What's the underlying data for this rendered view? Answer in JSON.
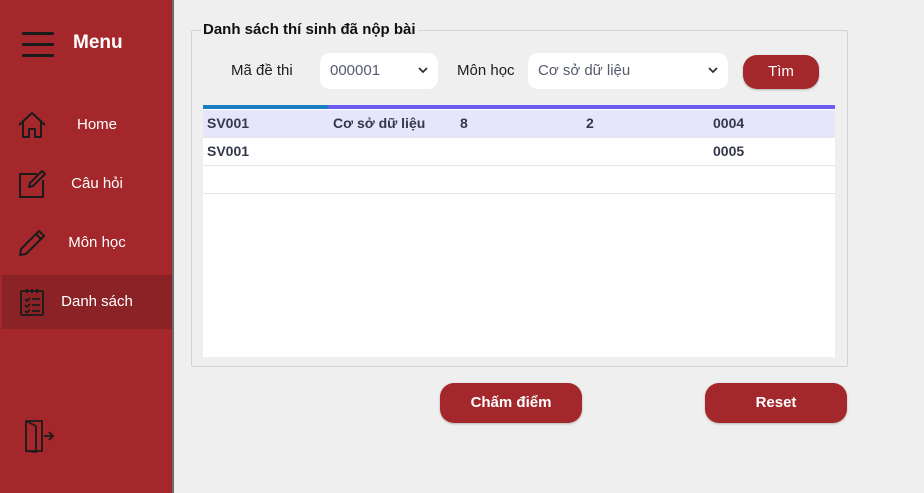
{
  "sidebar": {
    "menu_label": "Menu",
    "items": [
      {
        "label": "Home",
        "icon": "home-icon"
      },
      {
        "label": "Câu hỏi",
        "icon": "edit-icon"
      },
      {
        "label": "Môn học",
        "icon": "pencil-icon"
      },
      {
        "label": "Danh sách",
        "icon": "checklist-icon",
        "active": true
      }
    ],
    "exit_icon": "exit-icon"
  },
  "main": {
    "group_title": "Danh sách thí sinh đã nộp bài",
    "filters": {
      "exam_code_label": "Mã đề thi",
      "exam_code_value": "000001",
      "subject_label": "Môn học",
      "subject_value": "Cơ sở dữ liệu",
      "search_button": "Tìm"
    },
    "table": {
      "rows": [
        [
          "SV001",
          "Cơ sở dữ liệu",
          "8",
          "2",
          "0004"
        ],
        [
          "SV001",
          "",
          "",
          "",
          "0005"
        ],
        [
          "",
          "",
          "",
          "",
          ""
        ]
      ]
    },
    "grade_button": "Chấm điểm",
    "reset_button": "Reset"
  },
  "colors": {
    "accent": "#a3272b",
    "active_nav": "#8b2226",
    "content_bg": "#efefef",
    "selected_row": "#e6e6fa",
    "grid_bar_blue": "#1a7fc1",
    "grid_bar_purple": "#6a5cf0"
  }
}
